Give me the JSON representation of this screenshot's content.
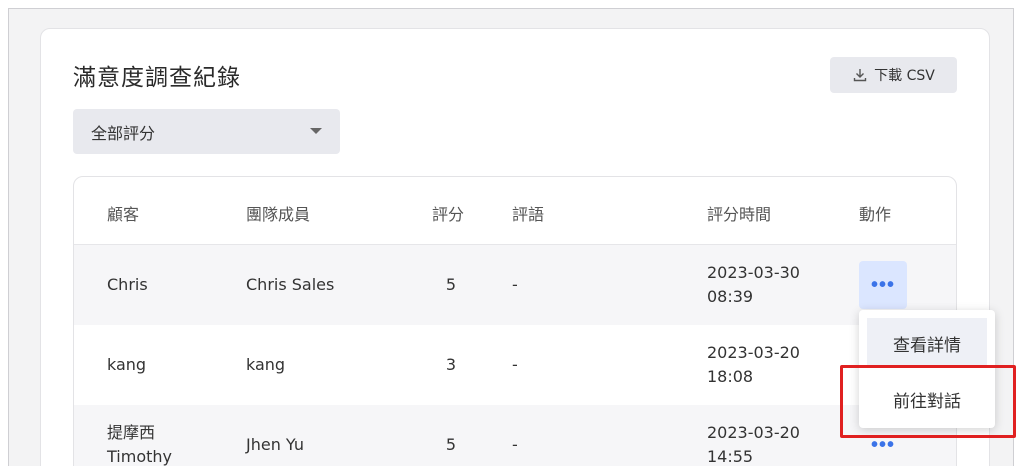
{
  "page": {
    "title": "滿意度調查紀錄",
    "download_label": "下載 CSV",
    "filter_value": "全部評分"
  },
  "table": {
    "headers": {
      "customer": "顧客",
      "member": "團隊成員",
      "score": "評分",
      "comment": "評語",
      "time": "評分時間",
      "action": "動作"
    },
    "rows": [
      {
        "customer": "Chris",
        "member": "Chris Sales",
        "score": "5",
        "comment": "-",
        "date": "2023-03-30",
        "clock": "08:39",
        "action": "•••"
      },
      {
        "customer": "kang",
        "member": "kang",
        "score": "3",
        "comment": "-",
        "date": "2023-03-20",
        "clock": "18:08",
        "action": "•••"
      },
      {
        "customer": "提摩西",
        "customer_line2": "Timothy",
        "member": "Jhen Yu",
        "score": "5",
        "comment": "-",
        "date": "2023-03-20",
        "clock": "14:55",
        "action": "•••"
      }
    ]
  },
  "menu": {
    "items": [
      "查看詳情",
      "前往對話"
    ]
  },
  "colors": {
    "accent": "#3b73e8",
    "highlight": "#e02020"
  }
}
